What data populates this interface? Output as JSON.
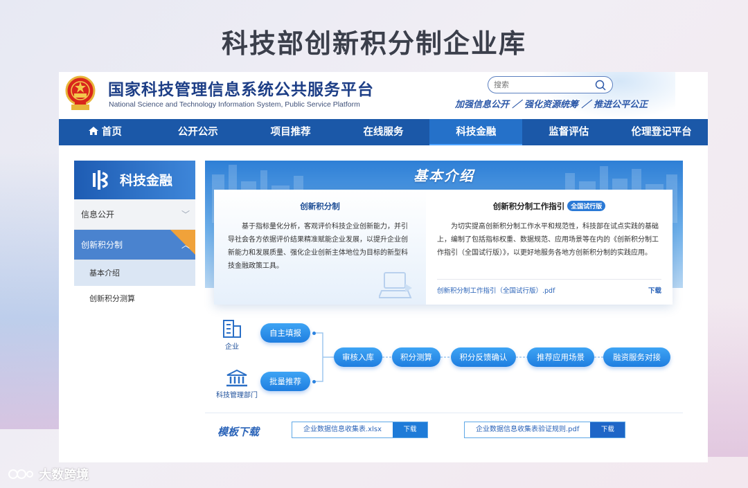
{
  "page_title": "科技部创新积分制企业库",
  "header": {
    "site_name": "国家科技管理信息系统公共服务平台",
    "site_name_en": "National Science and Technology Information System, Public Service Platform",
    "search_placeholder": "搜索",
    "slogan": "加强信息公开 ／ 强化资源统筹 ／ 推进公平公正"
  },
  "nav": {
    "items": [
      "首页",
      "公开公示",
      "项目推荐",
      "在线服务",
      "科技金融",
      "监督评估",
      "伦理登记平台"
    ],
    "active": "科技金融"
  },
  "sidebar": {
    "banner": "科技金融",
    "items": [
      {
        "label": "信息公开",
        "expanded": false
      },
      {
        "label": "创新积分制",
        "expanded": true
      }
    ],
    "subitems": [
      "基本介绍",
      "创新积分测算"
    ],
    "active_sub": "基本介绍"
  },
  "intro": {
    "title": "基本介绍",
    "left": {
      "heading": "创新积分制",
      "text": "基于指标量化分析，客观评价科技企业创新能力，并引导社会各方依据评价结果精准赋能企业发展，以提升企业创新能力和发展质量、强化企业创新主体地位为目标的新型科技金融政策工具。"
    },
    "right": {
      "heading": "创新积分制工作指引",
      "badge": "全国试行版",
      "text": "为切实提高创新积分制工作水平和规范性，科技部在试点实践的基础上，编制了包括指标权重、数据规范、应用场景等在内的《创新积分制工作指引（全国试行版）》，以更好地服务各地方创新积分制的实践应用。",
      "file": "创新积分制工作指引（全国试行版）.pdf",
      "download": "下载"
    }
  },
  "flow": {
    "actors": [
      "企业",
      "科技管理部门"
    ],
    "inputs": [
      "自主填报",
      "批量推荐"
    ],
    "steps": [
      "审核入库",
      "积分测算",
      "积分反馈确认",
      "推荐应用场景",
      "融资服务对接"
    ]
  },
  "templates": {
    "title": "模板下载",
    "files": [
      {
        "name": "企业数据信息收集表.xlsx",
        "button": "下载"
      },
      {
        "name": "企业数据信息收集表验证规则.pdf",
        "button": "下载"
      }
    ]
  },
  "watermark": "大数跨境",
  "colors": {
    "brand_blue": "#1b58a8",
    "accent_blue": "#2a79d6",
    "orange": "#f0a23a"
  }
}
